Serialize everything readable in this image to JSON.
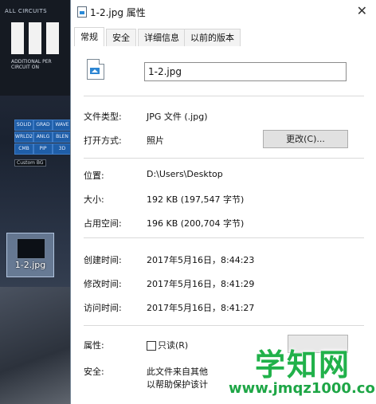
{
  "desktop": {
    "hero_top_text": "ALL CIRCUITS",
    "hero_caption_1": "ADDITIONAL PER CIRCUIT ON",
    "hero_caption_2": "",
    "tiles": [
      "SOLID",
      "GRAD",
      "WAVE",
      "WRLD2",
      "ANLG",
      "BLEN",
      "CMB",
      "PIP",
      "3D"
    ],
    "grid_label": "Custom BG",
    "file_icon_label": "1-2.jpg"
  },
  "dialog": {
    "title": "1-2.jpg 属性",
    "close_glyph": "✕",
    "tabs": [
      "常规",
      "安全",
      "详细信息",
      "以前的版本"
    ],
    "filename": "1-2.jpg",
    "rows": {
      "type_label": "文件类型:",
      "type_value": "JPG 文件 (.jpg)",
      "open_label": "打开方式:",
      "open_value": "照片",
      "change_button": "更改(C)...",
      "location_label": "位置:",
      "location_value": "D:\\Users\\Desktop",
      "size_label": "大小:",
      "size_value": "192 KB (197,547 字节)",
      "disk_label": "占用空间:",
      "disk_value": "196 KB (200,704 字节)",
      "created_label": "创建时间:",
      "created_value": "2017年5月16日，8:44:23",
      "modified_label": "修改时间:",
      "modified_value": "2017年5月16日，8:41:29",
      "accessed_label": "访问时间:",
      "accessed_value": "2017年5月16日，8:41:27",
      "attr_label": "属性:",
      "readonly_label": "只读(R)",
      "security_label": "安全:",
      "security_text_1": "此文件来自其他",
      "security_text_2": "以帮助保护该计"
    }
  },
  "watermark": {
    "title": "学知网",
    "url": "www.jmqz1000.com"
  }
}
